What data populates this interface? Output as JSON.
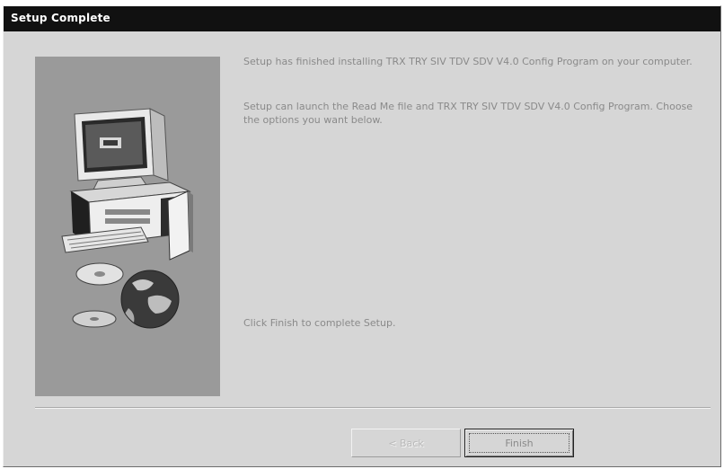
{
  "window": {
    "title": "Setup Complete"
  },
  "content": {
    "message_installed": "Setup has finished installing TRX TRY SIV TDV SDV V4.0 Config Program on your computer.",
    "message_launch": "Setup can launch the Read Me file and TRX TRY SIV TDV SDV V4.0 Config Program. Choose the options you want below.",
    "message_finish": "Click Finish to complete Setup."
  },
  "buttons": {
    "back_label": "< Back",
    "finish_label": "Finish"
  },
  "colors": {
    "titlebar": "#111111",
    "dialog_bg": "#d6d6d6",
    "side_panel": "#9a9a9a",
    "text": "#8a8a8a"
  },
  "icons": {
    "side_illustration": "computer-with-cd-and-globe"
  }
}
